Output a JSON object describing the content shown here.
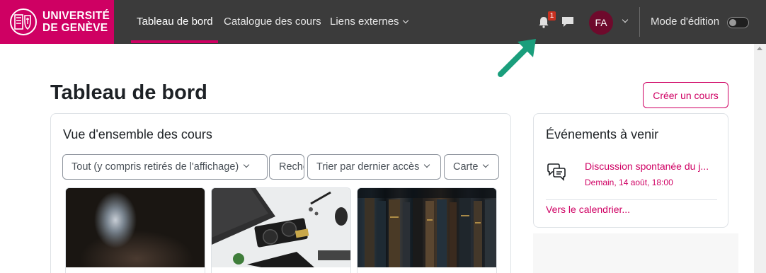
{
  "brand": {
    "line1": "UNIVERSITÉ",
    "line2": "DE GENÈVE",
    "color": "#cf0063"
  },
  "nav": {
    "items": [
      {
        "label": "Tableau de bord",
        "active": true
      },
      {
        "label": "Catalogue des cours",
        "active": false
      },
      {
        "label": "Liens externes",
        "active": false,
        "dropdown": true
      }
    ],
    "notifications_count": "1",
    "avatar_initials": "FA",
    "edit_mode_label": "Mode d'édition",
    "edit_mode_on": false
  },
  "page": {
    "title": "Tableau de bord",
    "create_button": "Créer un cours"
  },
  "overview": {
    "title": "Vue d'ensemble des cours",
    "filters": {
      "grouping": "Tout (y compris retirés de l'affichage)",
      "search_placeholder": "Rechercher",
      "sort": "Trier par dernier accès",
      "view": "Carte"
    },
    "courses": [
      {
        "image": "dark-fantasy-landscape"
      },
      {
        "image": "desk-with-graphics-card"
      },
      {
        "image": "bookshelf"
      }
    ]
  },
  "events": {
    "title": "Événements à venir",
    "items": [
      {
        "name": "Discussion spontanée du j...",
        "date": "Demain, 14 août, 18:00"
      }
    ],
    "calendar_link": "Vers le calendrier..."
  },
  "colors": {
    "navbar": "#3b3b3b",
    "accent": "#cf0063",
    "annotation_arrow": "#1a9e7c"
  }
}
